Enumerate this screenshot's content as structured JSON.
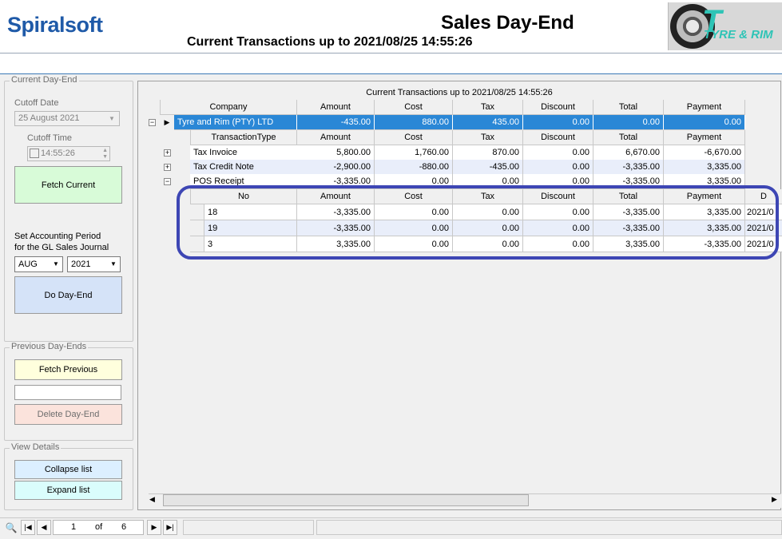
{
  "header": {
    "logo_text": "Spiralsoft",
    "title": "Sales Day-End",
    "subtitle": "Current Transactions up to  2021/08/25 14:55:26",
    "brand_logo": "TYRE & RIM"
  },
  "current_dayend": {
    "group_title": "Current Day-End",
    "cutoff_date_label": "Cutoff Date",
    "cutoff_date_value": "25   August   2021",
    "cutoff_time_label": "Cutoff Time",
    "cutoff_time_value": "14:55:26",
    "fetch_current": "Fetch Current",
    "period_label_1": "Set Accounting  Period",
    "period_label_2": "for the GL Sales Journal",
    "month_value": "AUG",
    "year_value": "2021",
    "do_dayend": "Do Day-End"
  },
  "previous_dayends": {
    "group_title": "Previous Day-Ends",
    "fetch_previous": "Fetch Previous",
    "input_value": "",
    "delete_dayend": "Delete Day-End"
  },
  "view_details": {
    "group_title": "View Details",
    "collapse_list": "Collapse list",
    "expand_list": "Expand list"
  },
  "grid": {
    "caption": "Current Transactions up to  2021/08/25 14:55:26",
    "company_headers": [
      "Company",
      "Amount",
      "Cost",
      "Tax",
      "Discount",
      "Total",
      "Payment"
    ],
    "company_row": [
      "Tyre and Rim (PTY) LTD",
      "-435.00",
      "880.00",
      "435.00",
      "0.00",
      "0.00",
      "0.00"
    ],
    "type_headers": [
      "TransactionType",
      "Amount",
      "Cost",
      "Tax",
      "Discount",
      "Total",
      "Payment"
    ],
    "type_rows": [
      [
        "Tax Invoice",
        "5,800.00",
        "1,760.00",
        "870.00",
        "0.00",
        "6,670.00",
        "-6,670.00"
      ],
      [
        "Tax Credit Note",
        "-2,900.00",
        "-880.00",
        "-435.00",
        "0.00",
        "-3,335.00",
        "3,335.00"
      ],
      [
        "POS Receipt",
        "-3,335.00",
        "0.00",
        "0.00",
        "0.00",
        "-3,335.00",
        "3,335.00"
      ]
    ],
    "detail_headers": [
      "No",
      "Amount",
      "Cost",
      "Tax",
      "Discount",
      "Total",
      "Payment",
      "D"
    ],
    "detail_rows": [
      [
        "18",
        "-3,335.00",
        "0.00",
        "0.00",
        "0.00",
        "-3,335.00",
        "3,335.00",
        "2021/0"
      ],
      [
        "19",
        "-3,335.00",
        "0.00",
        "0.00",
        "0.00",
        "-3,335.00",
        "3,335.00",
        "2021/0"
      ],
      [
        "3",
        "3,335.00",
        "0.00",
        "0.00",
        "0.00",
        "3,335.00",
        "-3,335.00",
        "2021/0"
      ]
    ]
  },
  "navigator": {
    "position": "1",
    "of_label": "of",
    "total": "6"
  },
  "icons": {
    "binoculars": "binoculars-icon",
    "first": "first-page-icon",
    "prev": "previous-page-icon",
    "next": "next-page-icon",
    "last": "last-page-icon"
  },
  "colors": {
    "selected_row": "#2a87d6",
    "fetch_current_bg": "#d8fbd8",
    "do_dayend_bg": "#d5e3f8",
    "fetch_previous_bg": "#ffffdd",
    "delete_dayend_bg": "#fbe3dc",
    "collapse_bg": "#dcefff",
    "expand_bg": "#dafdfc",
    "highlight_ring": "#3d46b4"
  }
}
